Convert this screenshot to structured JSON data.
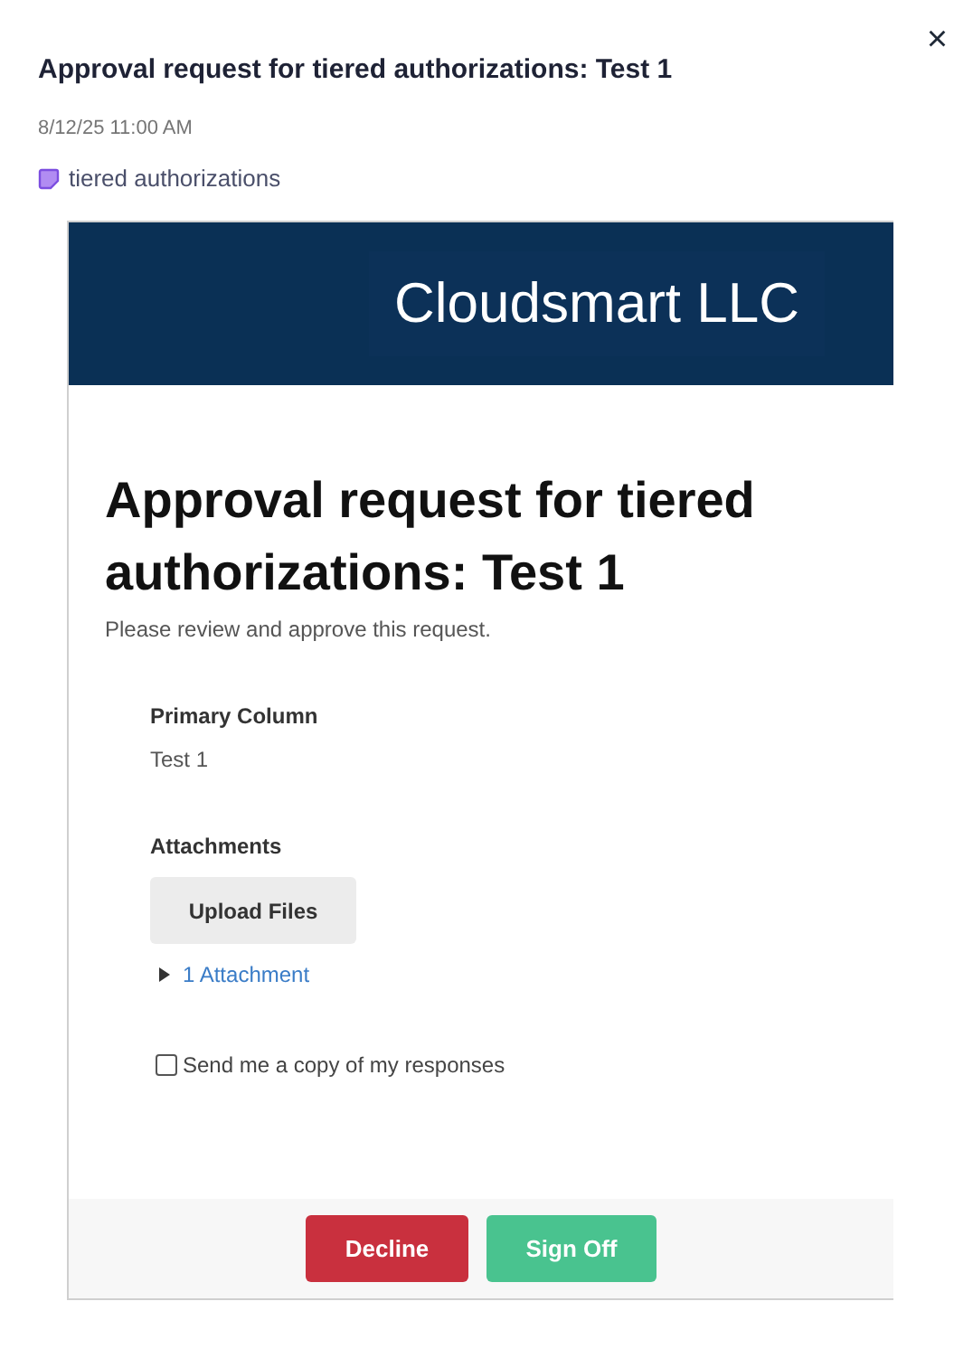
{
  "dialog": {
    "title": "Approval request for tiered authorizations: Test 1",
    "timestamp": "8/12/25 11:00 AM",
    "tag": {
      "label": "tiered authorizations"
    },
    "close": "×"
  },
  "form": {
    "logo_text": "Cloudsmart LLC",
    "heading": "Approval request for tiered authorizations: Test 1",
    "description": "Please review and approve this request.",
    "fields": [
      {
        "label": "Primary Column",
        "value": "Test 1"
      }
    ],
    "attachments": {
      "label": "Attachments",
      "upload_button": "Upload Files",
      "toggle": {
        "label": "1 Attachment",
        "expanded": false
      }
    },
    "copy_option": {
      "label": "Send me a copy of my responses",
      "checked": false
    },
    "buttons": [
      {
        "label": "Decline",
        "kind": "decline"
      },
      {
        "label": "Sign Off",
        "kind": "sign-off"
      }
    ]
  }
}
